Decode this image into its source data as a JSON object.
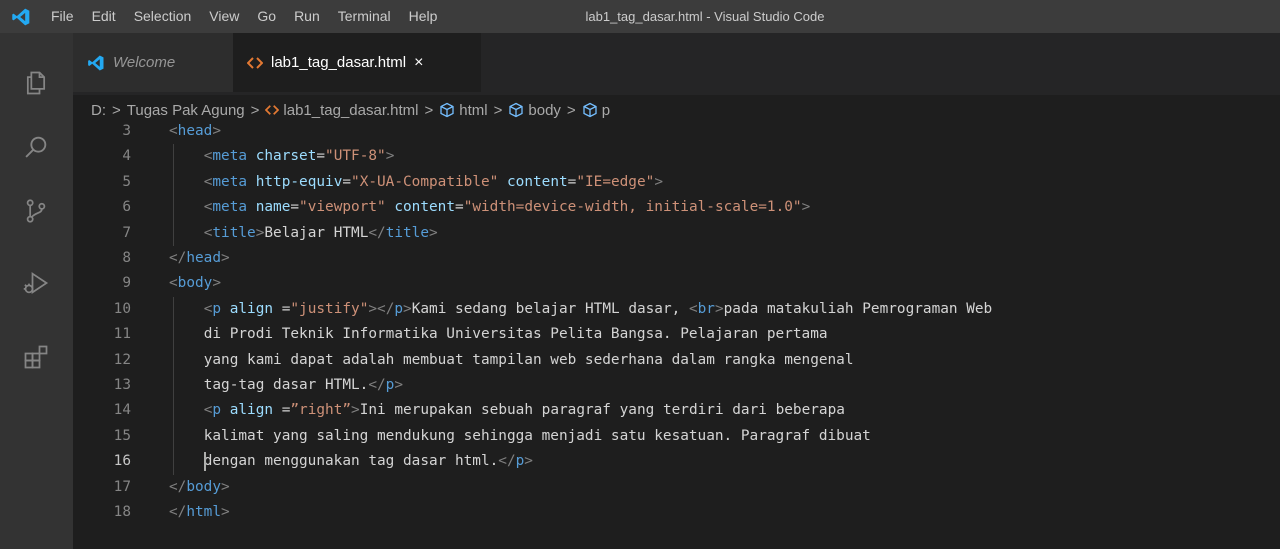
{
  "menu": [
    "File",
    "Edit",
    "Selection",
    "View",
    "Go",
    "Run",
    "Terminal",
    "Help"
  ],
  "window_title": "lab1_tag_dasar.html - Visual Studio Code",
  "activity_icons": [
    "explorer-icon",
    "search-icon",
    "source-control-icon",
    "run-debug-icon",
    "extensions-icon"
  ],
  "tabs": [
    {
      "label": "Welcome",
      "icon": "vscode-logo-icon",
      "active": false
    },
    {
      "label": "lab1_tag_dasar.html",
      "icon": "html-file-icon",
      "active": true,
      "close": "×"
    }
  ],
  "breadcrumb": {
    "drive": "D:",
    "folder": "Tugas Pak Agung",
    "file": "lab1_tag_dasar.html",
    "symbols": [
      "html",
      "body",
      "p"
    ],
    "separator": ">"
  },
  "colors": {
    "tag": "#569cd6",
    "punct": "#808080",
    "attr": "#9cdcfe",
    "string": "#ce9178",
    "text": "#d4d4d4",
    "line_number": "#858585",
    "background": "#1e1e1e"
  },
  "editor": {
    "current_line": "16",
    "lines": [
      {
        "n": "3",
        "tokens": [
          [
            "p",
            "<"
          ],
          [
            "tag",
            "head"
          ],
          [
            "p",
            ">"
          ]
        ]
      },
      {
        "n": "4",
        "tokens": [
          [
            "p",
            "<"
          ],
          [
            "tag",
            "meta"
          ],
          [
            "text",
            " "
          ],
          [
            "attr",
            "charset"
          ],
          [
            "text",
            "="
          ],
          [
            "str",
            "\"UTF-8\""
          ],
          [
            "p",
            ">"
          ]
        ]
      },
      {
        "n": "5",
        "tokens": [
          [
            "p",
            "<"
          ],
          [
            "tag",
            "meta"
          ],
          [
            "text",
            " "
          ],
          [
            "attr",
            "http-equiv"
          ],
          [
            "text",
            "="
          ],
          [
            "str",
            "\"X-UA-Compatible\""
          ],
          [
            "text",
            " "
          ],
          [
            "attr",
            "content"
          ],
          [
            "text",
            "="
          ],
          [
            "str",
            "\"IE=edge\""
          ],
          [
            "p",
            ">"
          ]
        ]
      },
      {
        "n": "6",
        "tokens": [
          [
            "p",
            "<"
          ],
          [
            "tag",
            "meta"
          ],
          [
            "text",
            " "
          ],
          [
            "attr",
            "name"
          ],
          [
            "text",
            "="
          ],
          [
            "str",
            "\"viewport\""
          ],
          [
            "text",
            " "
          ],
          [
            "attr",
            "content"
          ],
          [
            "text",
            "="
          ],
          [
            "str",
            "\"width=device-width, initial-scale=1.0\""
          ],
          [
            "p",
            ">"
          ]
        ]
      },
      {
        "n": "7",
        "tokens": [
          [
            "p",
            "<"
          ],
          [
            "tag",
            "title"
          ],
          [
            "p",
            ">"
          ],
          [
            "text",
            "Belajar HTML"
          ],
          [
            "p",
            "</"
          ],
          [
            "tag",
            "title"
          ],
          [
            "p",
            ">"
          ]
        ]
      },
      {
        "n": "8",
        "tokens": [
          [
            "p",
            "</"
          ],
          [
            "tag",
            "head"
          ],
          [
            "p",
            ">"
          ]
        ]
      },
      {
        "n": "9",
        "tokens": [
          [
            "p",
            "<"
          ],
          [
            "tag",
            "body"
          ],
          [
            "p",
            ">"
          ]
        ]
      },
      {
        "n": "10",
        "tokens": [
          [
            "p",
            "<"
          ],
          [
            "tag",
            "p"
          ],
          [
            "text",
            " "
          ],
          [
            "attr",
            "align"
          ],
          [
            "text",
            " ="
          ],
          [
            "str",
            "\"justify\""
          ],
          [
            "p",
            "></"
          ],
          [
            "tag",
            "p"
          ],
          [
            "p",
            ">"
          ],
          [
            "text",
            "Kami sedang belajar HTML dasar, "
          ],
          [
            "p",
            "<"
          ],
          [
            "tag",
            "br"
          ],
          [
            "p",
            ">"
          ],
          [
            "text",
            "pada matakuliah Pemrograman Web"
          ]
        ]
      },
      {
        "n": "11",
        "tokens": [
          [
            "text",
            "di Prodi Teknik Informatika Universitas Pelita Bangsa. Pelajaran pertama"
          ]
        ]
      },
      {
        "n": "12",
        "tokens": [
          [
            "text",
            "yang kami dapat adalah membuat tampilan web sederhana dalam rangka mengenal"
          ]
        ]
      },
      {
        "n": "13",
        "tokens": [
          [
            "text",
            "tag-tag dasar HTML."
          ],
          [
            "p",
            "</"
          ],
          [
            "tag",
            "p"
          ],
          [
            "p",
            ">"
          ]
        ]
      },
      {
        "n": "14",
        "tokens": [
          [
            "p",
            "<"
          ],
          [
            "tag",
            "p"
          ],
          [
            "text",
            " "
          ],
          [
            "attr",
            "align"
          ],
          [
            "text",
            " ="
          ],
          [
            "str",
            "”right”"
          ],
          [
            "p",
            ">"
          ],
          [
            "text",
            "Ini merupakan sebuah paragraf yang terdiri dari beberapa"
          ]
        ]
      },
      {
        "n": "15",
        "tokens": [
          [
            "text",
            "kalimat yang saling mendukung sehingga menjadi satu kesatuan. Paragraf dibuat"
          ]
        ]
      },
      {
        "n": "16",
        "tokens": [
          [
            "text",
            "dengan menggunakan tag dasar html."
          ],
          [
            "p",
            "</"
          ],
          [
            "tag",
            "p"
          ],
          [
            "p",
            ">"
          ]
        ]
      },
      {
        "n": "17",
        "tokens": [
          [
            "p",
            "</"
          ],
          [
            "tag",
            "body"
          ],
          [
            "p",
            ">"
          ]
        ]
      },
      {
        "n": "18",
        "tokens": [
          [
            "p",
            "</"
          ],
          [
            "tag",
            "html"
          ],
          [
            "p",
            ">"
          ]
        ]
      }
    ]
  }
}
